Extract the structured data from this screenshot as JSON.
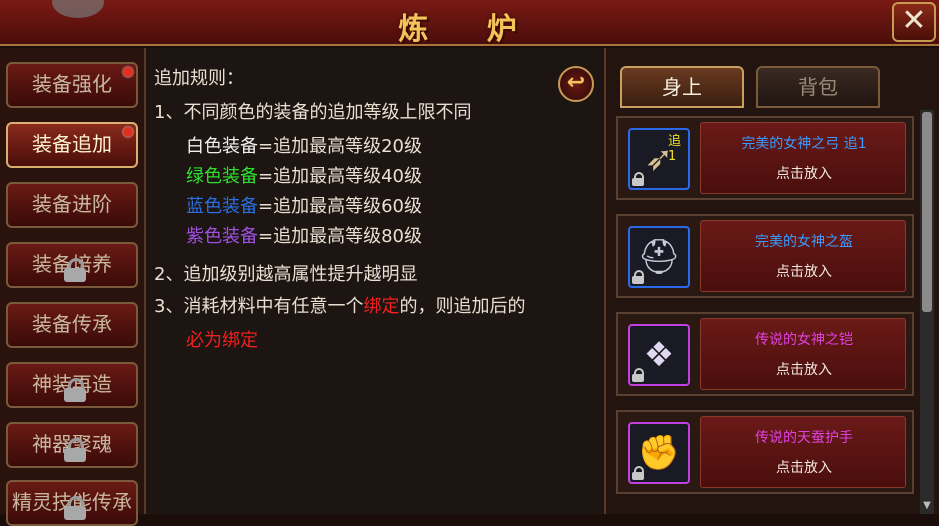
{
  "window": {
    "title": "炼 炉",
    "close_label": "✕"
  },
  "nav": [
    {
      "label": "装备强化",
      "active": false,
      "dot": true,
      "locked": false
    },
    {
      "label": "装备追加",
      "active": true,
      "dot": true,
      "locked": false
    },
    {
      "label": "装备进阶",
      "active": false,
      "dot": false,
      "locked": false
    },
    {
      "label": "装备培养",
      "active": false,
      "dot": false,
      "locked": true
    },
    {
      "label": "装备传承",
      "active": false,
      "dot": false,
      "locked": false
    },
    {
      "label": "神装再造",
      "active": false,
      "dot": false,
      "locked": true
    },
    {
      "label": "神器聚魂",
      "active": false,
      "dot": false,
      "locked": true
    },
    {
      "label": "精灵技能传承",
      "active": false,
      "dot": false,
      "locked": true
    }
  ],
  "rules": {
    "heading": "追加规则：",
    "rule1": "1、不同颜色的装备的追加等级上限不同",
    "white_name": "白色装备",
    "white_text": "=追加最高等级20级",
    "green_name": "绿色装备",
    "green_text": "=追加最高等级40级",
    "blue_name": "蓝色装备",
    "blue_text": "=追加最高等级60级",
    "purple_name": "紫色装备",
    "purple_text": "=追加最高等级80级",
    "rule2": "2、追加级别越高属性提升越明显",
    "rule3_a": "3、消耗材料中有任意一个",
    "rule3_b": "绑定",
    "rule3_c": "的，则追加后的",
    "rule3_d": "必为绑定",
    "back_icon": "↩"
  },
  "tabs": [
    {
      "label": "身上",
      "active": true
    },
    {
      "label": "背包",
      "active": false
    }
  ],
  "items": [
    {
      "name": "完美的女神之弓 追1",
      "action": "点击放入",
      "badge": "追1",
      "icon": "bow-icon",
      "glyph": "➶",
      "glyph_color": "#d8c090",
      "rarity_color": "#3a9aff",
      "frame": "blue"
    },
    {
      "name": "完美的女神之盔",
      "action": "点击放入",
      "badge": "",
      "icon": "helmet-icon",
      "glyph": "⛑",
      "glyph_color": "#c8c8d8",
      "rarity_color": "#3a9aff",
      "frame": "blue"
    },
    {
      "name": "传说的女神之铠",
      "action": "点击放入",
      "badge": "",
      "icon": "armor-icon",
      "glyph": "❖",
      "glyph_color": "#e0d8f0",
      "rarity_color": "#e040e0",
      "frame": "purple"
    },
    {
      "name": "传说的天蚕护手",
      "action": "点击放入",
      "badge": "",
      "icon": "gauntlet-icon",
      "glyph": "✊",
      "glyph_color": "#e0a040",
      "rarity_color": "#e040e0",
      "frame": "purple"
    }
  ],
  "colors": {
    "title": "#f4c45a",
    "white": "#f0f0f0",
    "green": "#2ee02e",
    "blue": "#2a70e0",
    "purple": "#a050e0",
    "red": "#f02020"
  }
}
